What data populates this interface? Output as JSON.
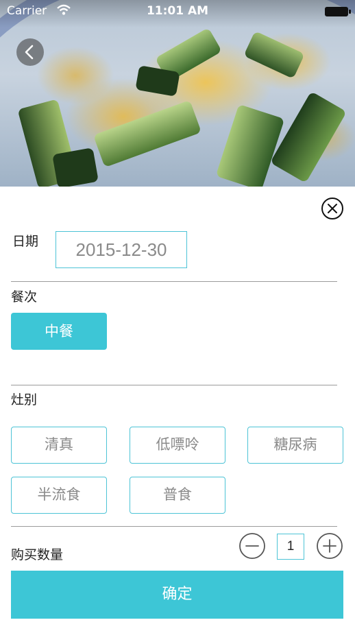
{
  "status_bar": {
    "carrier": "Carrier",
    "time": "11:01 AM"
  },
  "icons": {
    "back": "chevron-left-icon",
    "close": "close-circle-icon",
    "minus": "minus-circle-icon",
    "plus": "plus-circle-icon",
    "wifi": "wifi-icon",
    "battery": "battery-icon"
  },
  "hero": {
    "image": "food-photo-cucumber-scrambled-eggs"
  },
  "form": {
    "date_label": "日期",
    "date_value": "2015-12-30",
    "meal_label": "餐次",
    "meal_selected": "中餐",
    "kitchen_label": "灶别",
    "kitchen_options": [
      "清真",
      "低嘌呤",
      "糖尿病",
      "半流食",
      "普食"
    ],
    "quantity_label": "购买数量",
    "quantity_value": "1",
    "confirm_label": "确定"
  },
  "colors": {
    "accent": "#3dc6d6",
    "border": "#4cc3d6",
    "muted_text": "#8a8a8a",
    "divider": "#9a9a9a"
  }
}
